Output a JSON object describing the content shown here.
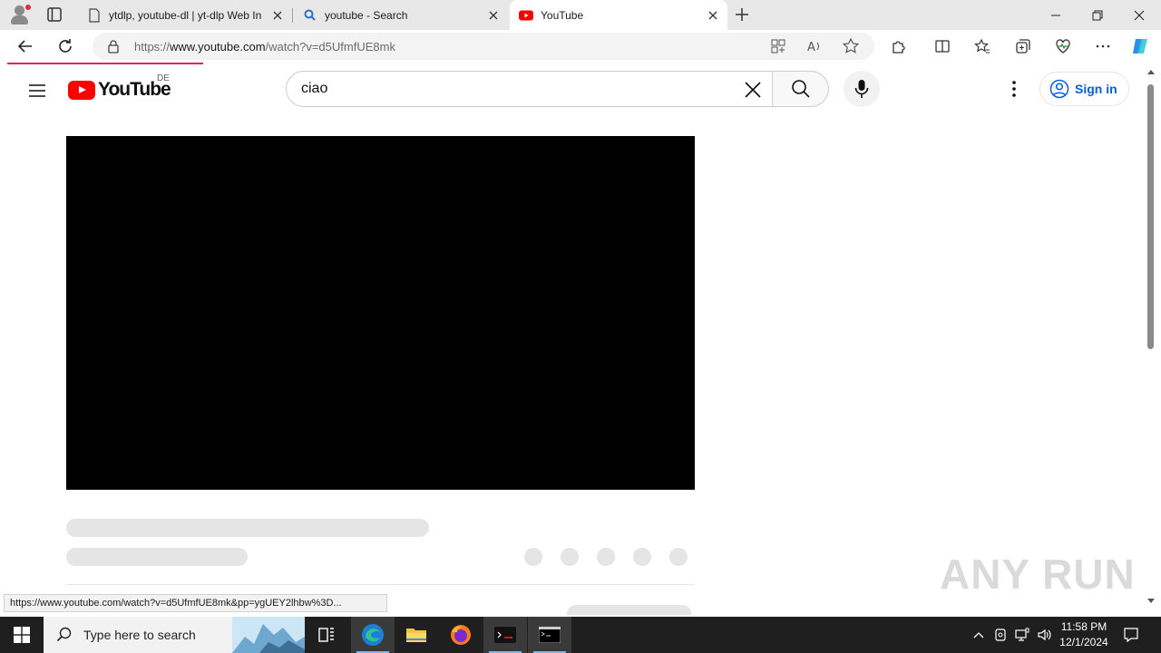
{
  "browser": {
    "tabs": [
      {
        "title": "ytdlp, youtube-dl | yt-dlp Web In",
        "icon": "page-icon"
      },
      {
        "title": "youtube - Search",
        "icon": "search-icon"
      },
      {
        "title": "YouTube",
        "icon": "youtube-icon",
        "active": true
      }
    ],
    "address": {
      "url_prefix": "https://",
      "url_host": "www.youtube.com",
      "url_path": "/watch?v=d5UfmfUE8mk"
    }
  },
  "youtube": {
    "logo_text": "YouTube",
    "region": "DE",
    "search_value": "ciao",
    "signin_label": "Sign in"
  },
  "status_url": "https://www.youtube.com/watch?v=d5UfmfUE8mk&pp=ygUEY2lhbw%3D...",
  "watermark": "ANY RUN",
  "taskbar": {
    "search_placeholder": "Type here to search",
    "time": "11:58 PM",
    "date": "12/1/2024"
  },
  "colors": {
    "youtube_red": "#ff0000",
    "signin_blue": "#065fd4",
    "loading_bar": "#e9235a"
  }
}
